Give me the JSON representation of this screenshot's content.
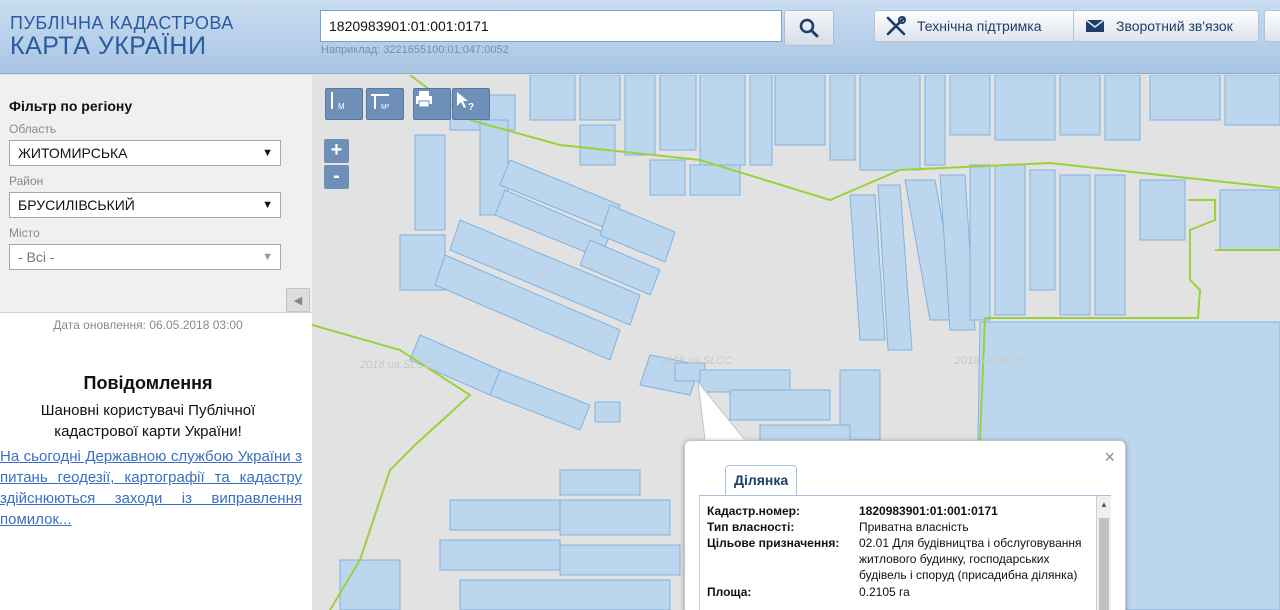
{
  "header": {
    "logo_line1": "ПУБЛІЧНА КАДАСТРОВА",
    "logo_line2": "КАРТА УКРАЇНИ",
    "search_value": "1820983901:01:001:0171",
    "search_hint": "Наприклад: 3221655100:01:047:0052",
    "support_label": "Технічна підтримка",
    "feedback_label": "Зворотний зв'язок",
    "icons": [
      "search-icon",
      "tools-icon",
      "mail-icon"
    ]
  },
  "filter": {
    "title": "Фільтр по регіону",
    "region_label": "Область",
    "region_value": "ЖИТОМИРСЬКА",
    "district_label": "Район",
    "district_value": "БРУСИЛІВСЬКИЙ",
    "city_label": "Місто",
    "city_value": "- Всі -"
  },
  "sidebar": {
    "updated": "Дата оновлення: 06.05.2018 03:00",
    "notice_title": "Повідомлення",
    "notice_body": "Шановні користувачі Публічної кадастрової карти України!",
    "notice_link": "На сьогодні Державною службою України з питань геодезії, картографії та кадастру здійснюються заходи із виправлення помилок..."
  },
  "map": {
    "tools": [
      "ruler-icon",
      "area-measure-icon",
      "print-icon",
      "identify-icon"
    ],
    "zoom_in": "+",
    "zoom_out": "-",
    "watermark": "2018 ua.SLCC",
    "colors": {
      "parcel_fill": "#bcd6ee",
      "parcel_stroke": "#7fb3e0",
      "boundary": "#9bd13a"
    }
  },
  "popup": {
    "tab": "Ділянка",
    "close": "×",
    "rows": [
      {
        "key": "Кадастр.номер:",
        "value": "1820983901:01:001:0171"
      },
      {
        "key": "Тип власності:",
        "value": "Приватна власність"
      },
      {
        "key": "Цільове призначення:",
        "value": "02.01 Для будівництва і обслуговування житлового будинку, господарських будівель і споруд (присадибна ділянка)"
      },
      {
        "key": "Площа:",
        "value": "0.2105 га"
      }
    ]
  }
}
